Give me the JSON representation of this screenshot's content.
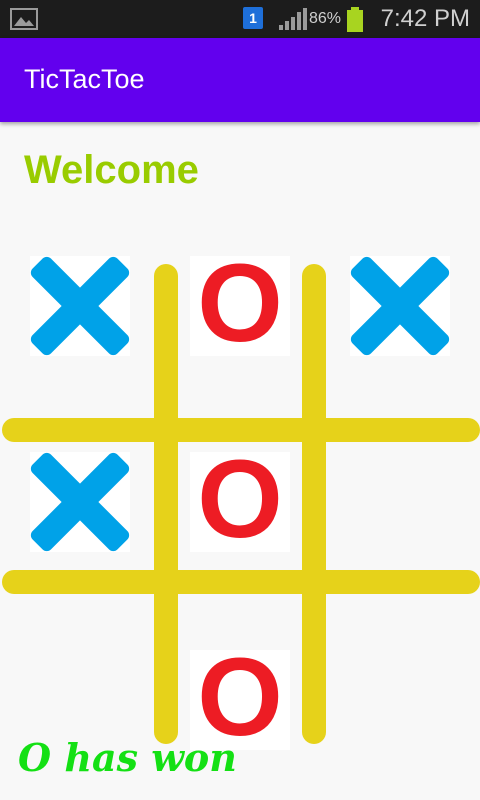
{
  "status_bar": {
    "notification_badge": "1",
    "battery_percent": "86%",
    "time": "7:42 PM"
  },
  "app_bar": {
    "title": "TicTacToe"
  },
  "welcome_text": "Welcome",
  "board": {
    "cells": [
      "X",
      "O",
      "X",
      "X",
      "O",
      "",
      "",
      "O",
      ""
    ],
    "x_color": "#00a2e8",
    "o_color": "#ed1c24",
    "line_color": "#e6d21a"
  },
  "result_text": "O has won",
  "icons": [
    "gallery-icon",
    "signal-icon",
    "battery-icon"
  ]
}
